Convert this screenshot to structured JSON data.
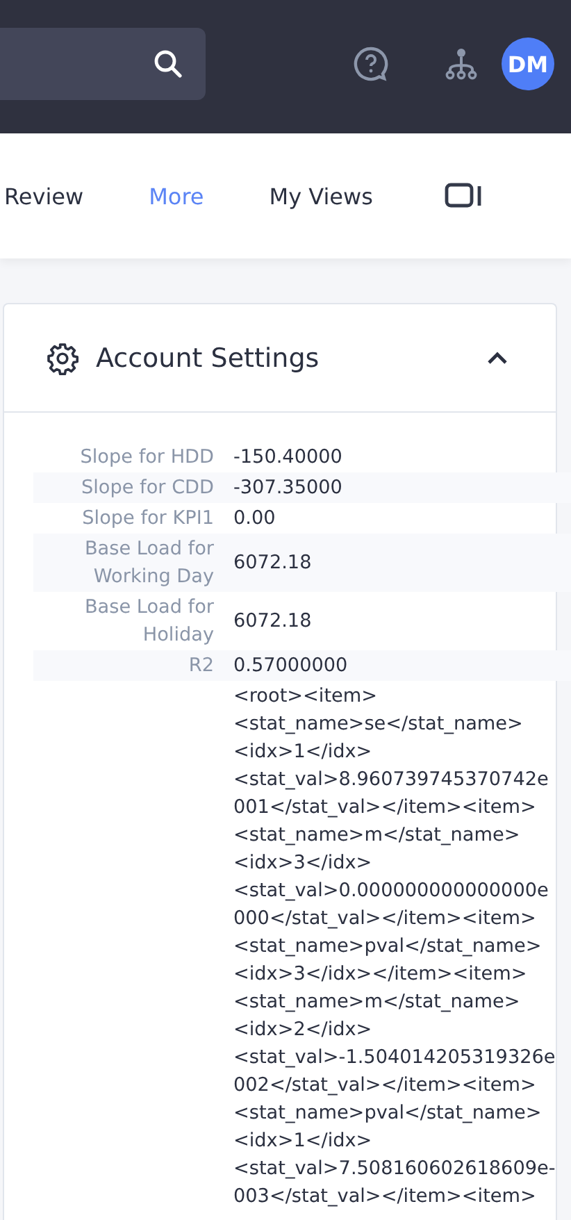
{
  "header": {
    "avatar": "DM"
  },
  "tabs": [
    {
      "label": "Review",
      "selected": false
    },
    {
      "label": "More",
      "selected": true
    },
    {
      "label": "My Views",
      "selected": false
    }
  ],
  "panel": {
    "title": "Account Settings",
    "expanded": true,
    "rows": [
      {
        "label": "Slope for HDD",
        "value_lines": [
          "-150.40000"
        ]
      },
      {
        "label": "Slope for CDD",
        "value_lines": [
          "-307.35000"
        ]
      },
      {
        "label": "Slope for KPI1",
        "value_lines": [
          "0.00"
        ]
      },
      {
        "label": "Base Load for Working Day",
        "value_lines": [
          "6072.18"
        ]
      },
      {
        "label": "Base Load for Holiday",
        "value_lines": [
          "6072.18"
        ]
      },
      {
        "label": "R2",
        "value_lines": [
          "0.57000000"
        ]
      },
      {
        "value_lines": [
          "<root><item>",
          "<stat_name>se</stat_name>",
          "<idx>1</idx>",
          "<stat_val>8.960739745370742e",
          "001</stat_val></item><item>",
          "<stat_name>m</stat_name>",
          "<idx>3</idx>",
          "<stat_val>0.000000000000000e",
          "000</stat_val></item><item>",
          "<stat_name>pval</stat_name>",
          "<idx>3</idx></item><item>",
          "<stat_name>m</stat_name>",
          "<idx>2</idx>",
          "<stat_val>-1.504014205319326e",
          "002</stat_val></item><item>",
          "<stat_name>pval</stat_name>",
          "<idx>1</idx>",
          "<stat_val>7.508160602618609e-",
          "003</stat_val></item><item>"
        ]
      }
    ]
  }
}
